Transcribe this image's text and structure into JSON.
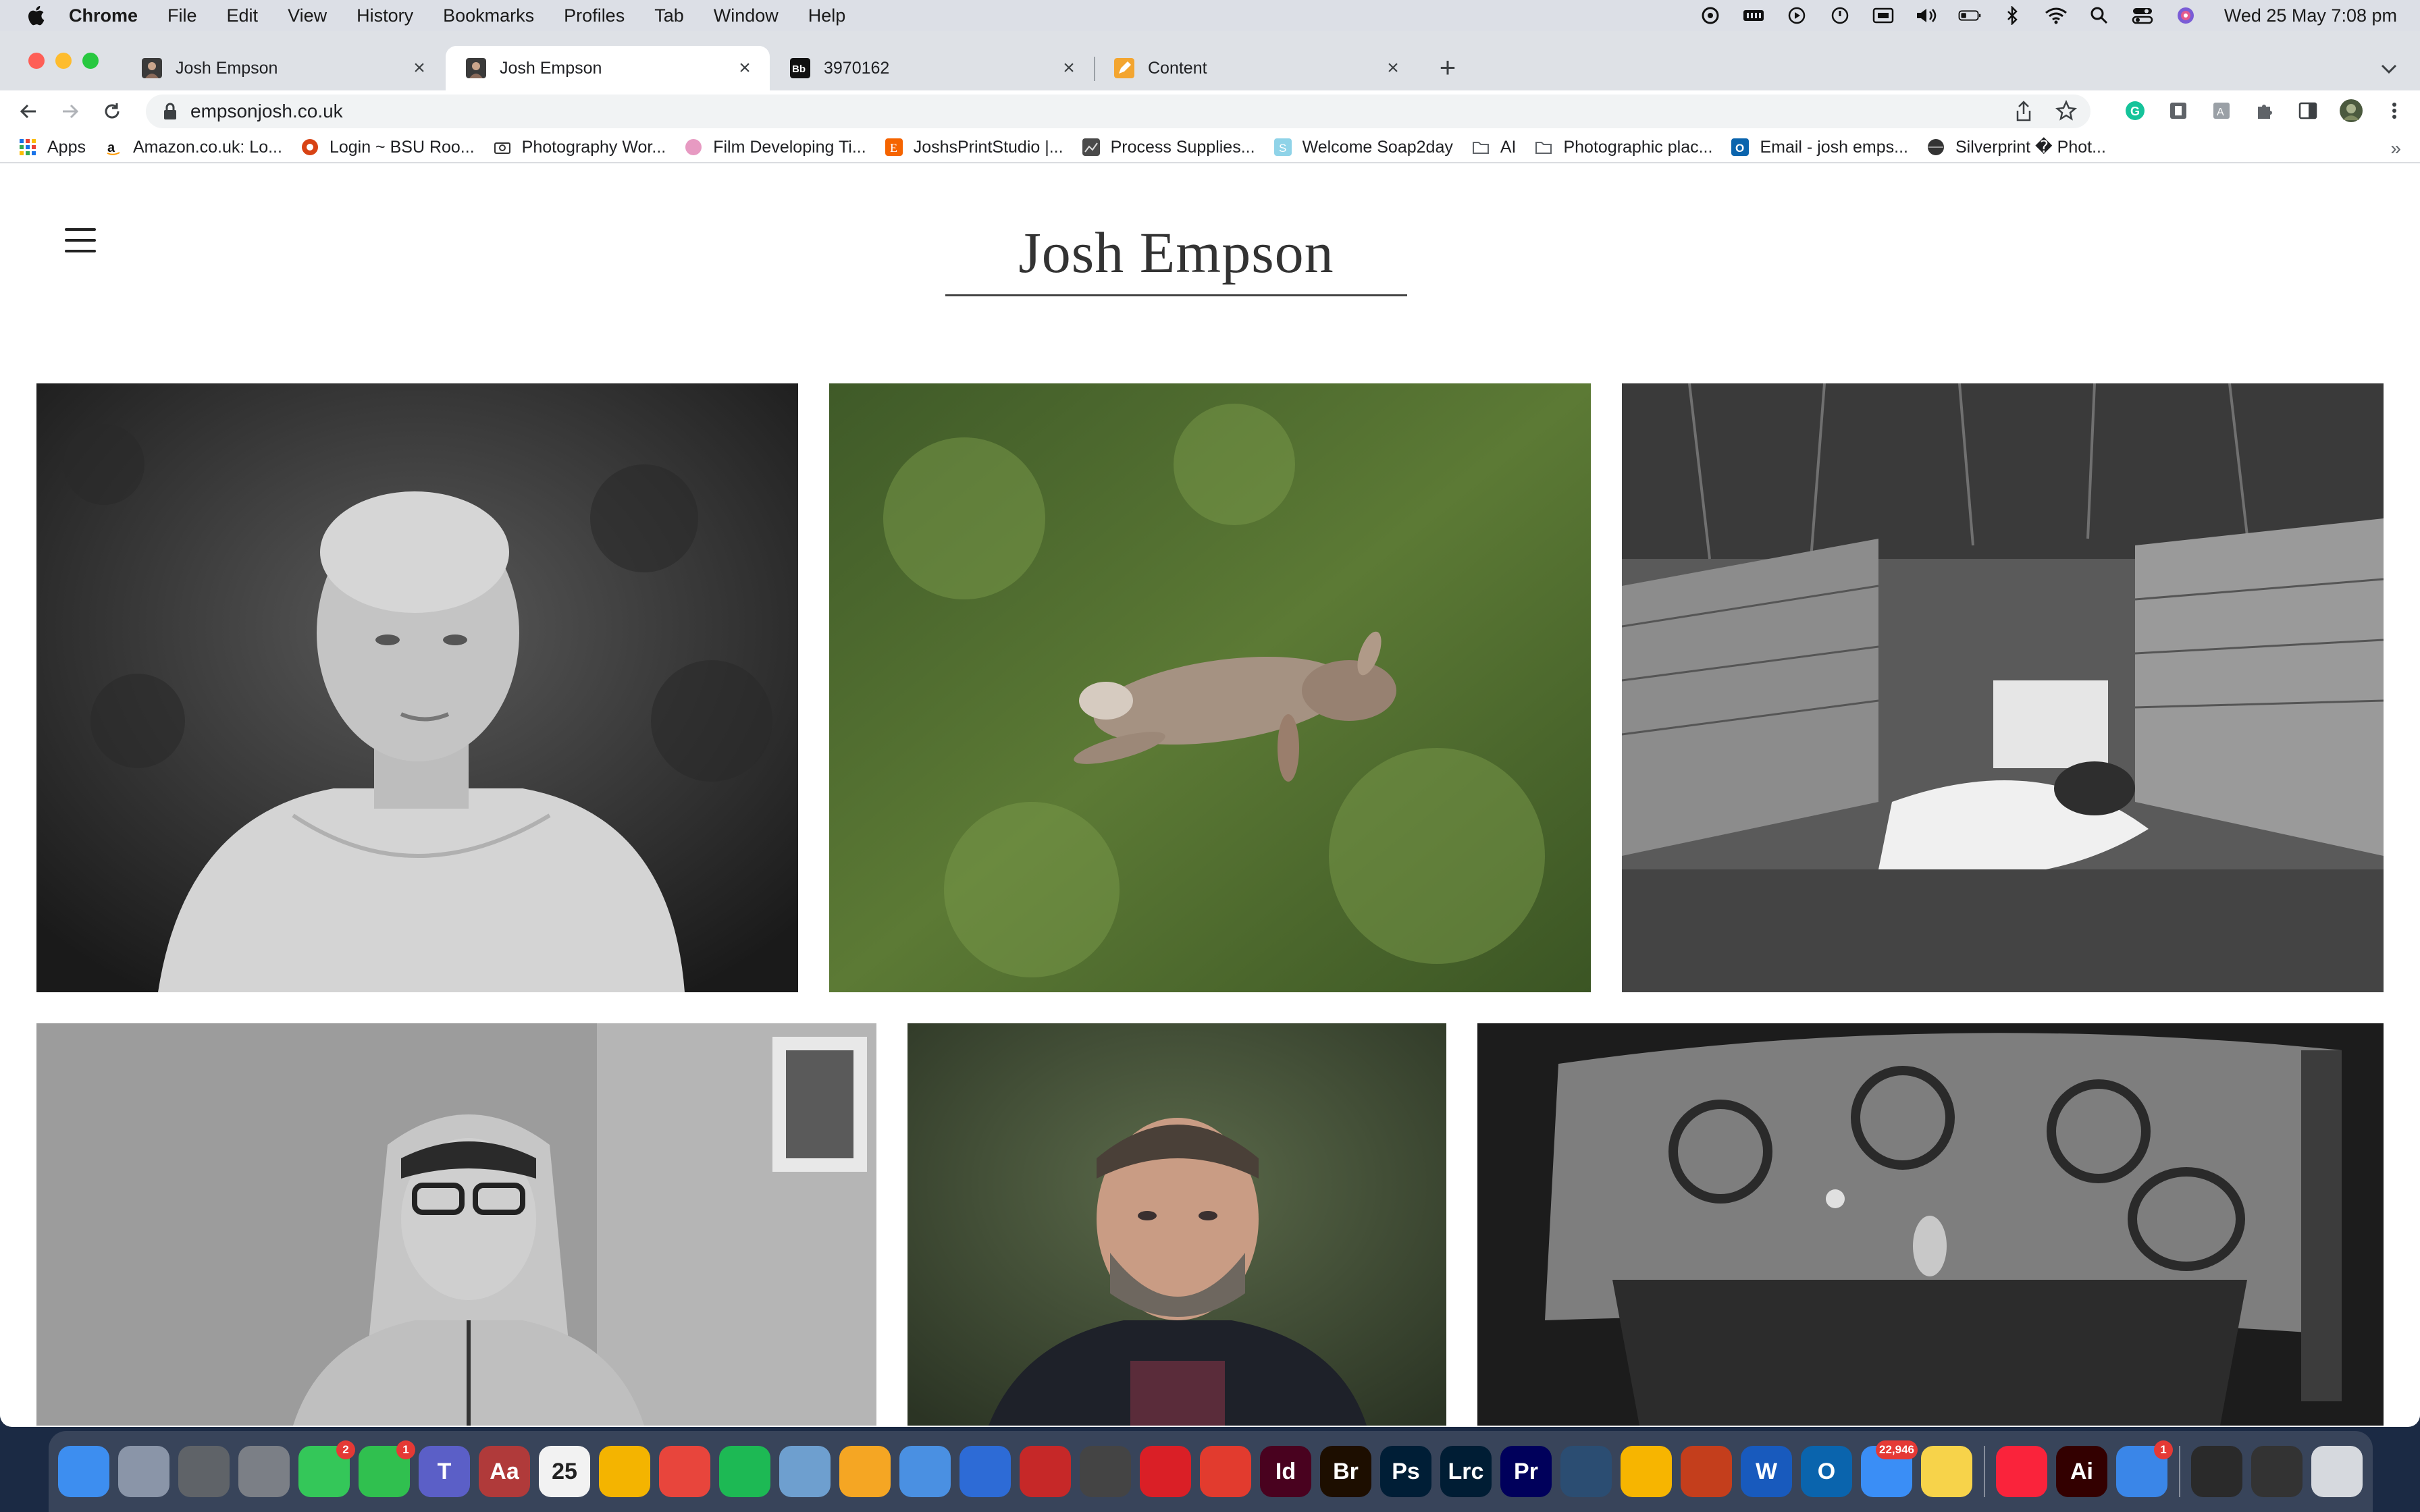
{
  "menubar": {
    "app_name": "Chrome",
    "items": [
      "File",
      "Edit",
      "View",
      "History",
      "Bookmarks",
      "Profiles",
      "Tab",
      "Window",
      "Help"
    ],
    "clock": "Wed 25 May  7:08 pm"
  },
  "tabs": [
    {
      "title": "Josh Empson",
      "favicon": "portrait-favicon"
    },
    {
      "title": "Josh Empson",
      "favicon": "portrait-favicon"
    },
    {
      "title": "3970162",
      "favicon": "bb-favicon"
    },
    {
      "title": "Content",
      "favicon": "pencil-favicon"
    }
  ],
  "address_bar": {
    "url": "empsonjosh.co.uk"
  },
  "bookmarks": [
    {
      "label": "Apps",
      "icon": "apps-grid-icon"
    },
    {
      "label": "Amazon.co.uk: Lo...",
      "icon": "amazon-icon"
    },
    {
      "label": "Login ~ BSU Roo...",
      "icon": "bsu-icon"
    },
    {
      "label": "Photography Wor...",
      "icon": "camera-icon"
    },
    {
      "label": "Film Developing Ti...",
      "icon": "film-icon"
    },
    {
      "label": "JoshsPrintStudio |...",
      "icon": "etsy-icon"
    },
    {
      "label": "Process Supplies...",
      "icon": "process-icon"
    },
    {
      "label": "Welcome Soap2day",
      "icon": "soap-icon"
    },
    {
      "label": "AI",
      "icon": "folder-icon"
    },
    {
      "label": "Photographic plac...",
      "icon": "folder-icon"
    },
    {
      "label": "Email - josh emps...",
      "icon": "outlook-icon"
    },
    {
      "label": "Silverprint � Phot...",
      "icon": "silverprint-icon"
    }
  ],
  "page": {
    "site_title": "Josh Empson"
  },
  "dock": {
    "apps": [
      {
        "name": "finder",
        "label": "",
        "color": "#3d8ef0"
      },
      {
        "name": "launchpad",
        "label": "",
        "color": "#8a95a8"
      },
      {
        "name": "calculator",
        "label": "",
        "color": "#5f6368"
      },
      {
        "name": "system-preferences",
        "label": "",
        "color": "#7b7f86"
      },
      {
        "name": "messages",
        "label": "",
        "color": "#34c759",
        "badge": "2"
      },
      {
        "name": "facetime",
        "label": "",
        "color": "#30c04f",
        "badge": "1"
      },
      {
        "name": "teams",
        "label": "T",
        "color": "#5b5fc7"
      },
      {
        "name": "dictionary",
        "label": "Aa",
        "color": "#b03a3a"
      },
      {
        "name": "calendar",
        "label": "25",
        "color": "#f2f2f2"
      },
      {
        "name": "google-drive",
        "label": "",
        "color": "#f4b400"
      },
      {
        "name": "chrome",
        "label": "",
        "color": "#e8453c"
      },
      {
        "name": "spotify",
        "label": "",
        "color": "#1db954"
      },
      {
        "name": "preview",
        "label": "",
        "color": "#6e9fcf"
      },
      {
        "name": "photos",
        "label": "",
        "color": "#f5a623"
      },
      {
        "name": "weather",
        "label": "",
        "color": "#4a90e2"
      },
      {
        "name": "image-capture",
        "label": "",
        "color": "#2d6bd6"
      },
      {
        "name": "photo-booth",
        "label": "",
        "color": "#c62828"
      },
      {
        "name": "aperture",
        "label": "",
        "color": "#444"
      },
      {
        "name": "creative-cloud",
        "label": "",
        "color": "#da1f26"
      },
      {
        "name": "acrobat",
        "label": "",
        "color": "#e23b2e"
      },
      {
        "name": "indesign",
        "label": "Id",
        "color": "#49021f"
      },
      {
        "name": "bridge",
        "label": "Br",
        "color": "#1d0e00"
      },
      {
        "name": "photoshop",
        "label": "Ps",
        "color": "#001e36"
      },
      {
        "name": "lightroom-classic",
        "label": "Lrc",
        "color": "#001d34"
      },
      {
        "name": "premiere",
        "label": "Pr",
        "color": "#00005b"
      },
      {
        "name": "quicktime",
        "label": "",
        "color": "#2b4d72"
      },
      {
        "name": "sketch",
        "label": "",
        "color": "#f7b500"
      },
      {
        "name": "powerpoint",
        "label": "",
        "color": "#c43e1c"
      },
      {
        "name": "word",
        "label": "W",
        "color": "#185abd"
      },
      {
        "name": "outlook",
        "label": "O",
        "color": "#0a64ad"
      },
      {
        "name": "mail",
        "label": "",
        "color": "#3a8ef6",
        "badge": "22,946"
      },
      {
        "name": "notes",
        "label": "",
        "color": "#f7d34a"
      },
      {
        "name": "music",
        "label": "",
        "color": "#fa233b"
      },
      {
        "name": "illustrator",
        "label": "Ai",
        "color": "#330000"
      },
      {
        "name": "network-app",
        "label": "",
        "color": "#3a86e8",
        "badge": "1"
      },
      {
        "name": "downloads-stack",
        "label": "",
        "color": "#2a2a2a"
      },
      {
        "name": "recent-stack",
        "label": "",
        "color": "#333"
      },
      {
        "name": "trash",
        "label": "",
        "color": "#d6d9de"
      }
    ]
  }
}
